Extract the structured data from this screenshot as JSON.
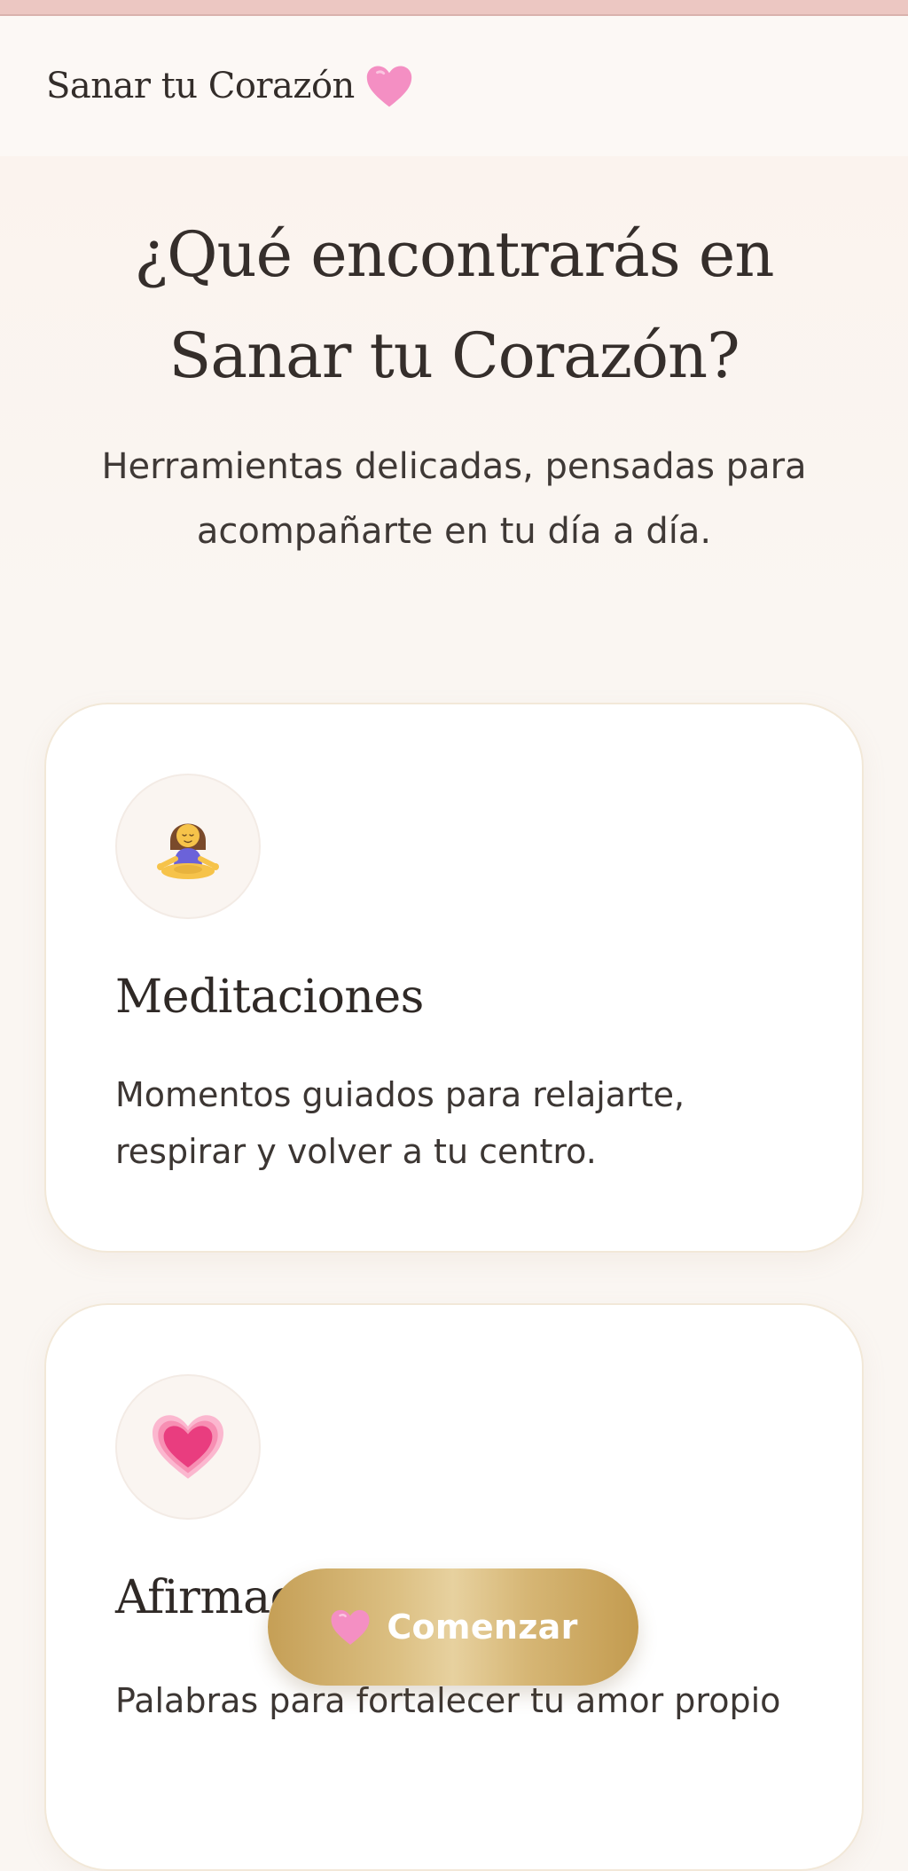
{
  "header": {
    "brand_name": "Sanar tu Corazón",
    "brand_icon": "pink-heart-icon"
  },
  "hero": {
    "title": "¿Qué encontrarás en Sanar tu Corazón?",
    "subtitle": "Herramientas delicadas, pensadas para acompañarte en tu día a día."
  },
  "features": [
    {
      "icon": "meditating-woman-icon",
      "title": "Meditaciones",
      "description": "Momentos guiados para relajarte, respirar y volver a tu centro."
    },
    {
      "icon": "beating-heart-icon",
      "title": "Afirmaciones",
      "description": "Palabras para fortalecer tu amor propio"
    }
  ],
  "cta": {
    "label": "Comenzar",
    "icon": "pink-heart-icon"
  },
  "colors": {
    "page_background": "#faf6f2",
    "top_strip": "#ecc7c2",
    "card_background": "#ffffff",
    "card_border": "#f2e8d8",
    "button_gold": "#d6b675",
    "heart_pink": "#f48fc3",
    "text_dark": "#352e2b"
  }
}
